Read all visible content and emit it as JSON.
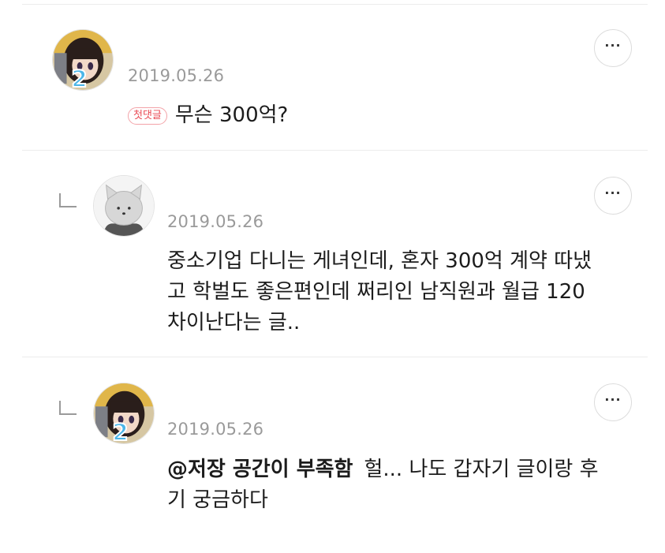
{
  "comments": [
    {
      "date": "2019.05.26",
      "badge": "첫댓글",
      "text": "무슨 300억?",
      "avatar": "anime-girl-avatar",
      "avatar_number": "2"
    },
    {
      "date": "2019.05.26",
      "line1": "중소기업 다니는 게녀인데, 혼자 300억 계약 따냈",
      "line2": "고 학벌도 좋은편인데 쩌리인 남직원과 월급 120",
      "line3": "차이난다는 글..",
      "avatar": "gray-cat-avatar"
    },
    {
      "date": "2019.05.26",
      "mention": "@저장 공간이 부족함",
      "line1": "헐... 나도 갑자기 글이랑 후",
      "line2": "기 궁금하다",
      "avatar": "anime-girl-avatar",
      "avatar_number": "2"
    }
  ],
  "more_button_label": "···",
  "icons": {
    "more": "more-options-icon",
    "reply": "reply-arrow-icon"
  },
  "colors": {
    "badge": "#e94b55",
    "date": "#9a9a9a",
    "divider": "#ececec"
  }
}
